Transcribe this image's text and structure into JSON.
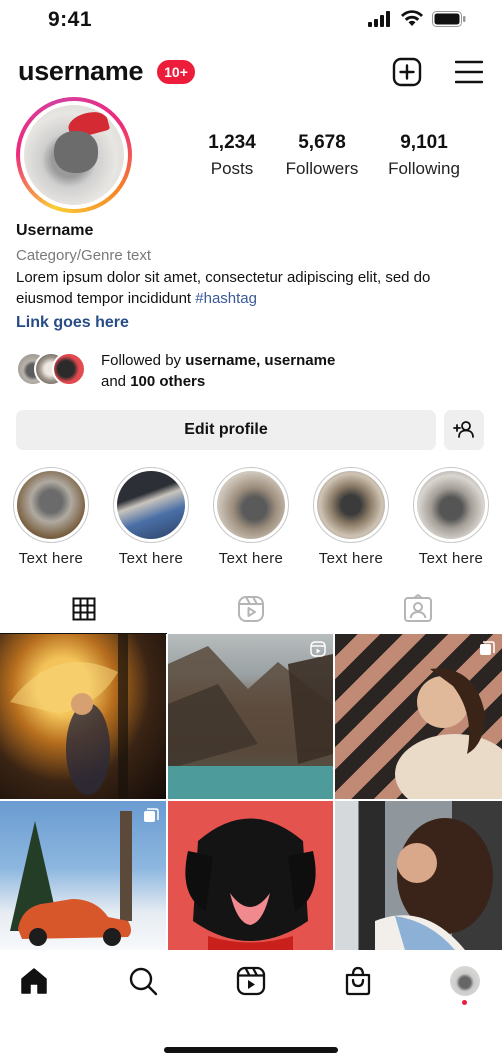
{
  "status_bar": {
    "time": "9:41"
  },
  "header": {
    "username": "username",
    "notification_badge": "10+",
    "new_post_icon": "plus-square-icon",
    "menu_icon": "hamburger-menu-icon"
  },
  "stats": [
    {
      "value": "1,234",
      "label": "Posts"
    },
    {
      "value": "5,678",
      "label": "Followers"
    },
    {
      "value": "9,101",
      "label": "Following"
    }
  ],
  "bio": {
    "name": "Username",
    "category": "Category/Genre text",
    "text": "Lorem ipsum dolor sit amet, consectetur adipiscing elit, sed do eiusmod tempor incididunt ",
    "hashtag": "#hashtag",
    "link": "Link goes here"
  },
  "followed_by": {
    "prefix": "Followed by ",
    "users": "username, username",
    "and": "and ",
    "others": "100 others"
  },
  "actions": {
    "edit_profile_label": "Edit profile",
    "add_person_icon": "add-person-icon"
  },
  "highlights": [
    {
      "label": "Text  here"
    },
    {
      "label": "Text  here"
    },
    {
      "label": "Text  here"
    },
    {
      "label": "Text  here"
    },
    {
      "label": "Text  here"
    }
  ],
  "tabs": [
    {
      "name": "posts",
      "icon": "grid-icon",
      "active": true
    },
    {
      "name": "reels",
      "icon": "reels-icon",
      "active": false
    },
    {
      "name": "tagged",
      "icon": "tagged-icon",
      "active": false
    }
  ],
  "posts": [
    {
      "subject": "woman with umbrella",
      "badge": ""
    },
    {
      "subject": "mountain lake",
      "badge": "reels-icon"
    },
    {
      "subject": "woman portrait",
      "badge": "carousel-icon"
    },
    {
      "subject": "orange car in snow",
      "badge": "carousel-icon"
    },
    {
      "subject": "black dog",
      "badge": ""
    },
    {
      "subject": "curly hair woman",
      "badge": ""
    }
  ],
  "bottom_nav": [
    {
      "name": "home",
      "icon": "home-icon",
      "active": true
    },
    {
      "name": "search",
      "icon": "search-icon",
      "active": false
    },
    {
      "name": "reels",
      "icon": "reels-icon",
      "active": false
    },
    {
      "name": "shop",
      "icon": "shopping-bag-icon",
      "active": false
    },
    {
      "name": "profile",
      "icon": "profile-avatar-icon",
      "active": false
    }
  ],
  "colors": {
    "badge_red": "#ed1c3b",
    "link_blue": "#284d86",
    "hashtag_blue": "#3b5998",
    "button_gray": "#efefef"
  }
}
